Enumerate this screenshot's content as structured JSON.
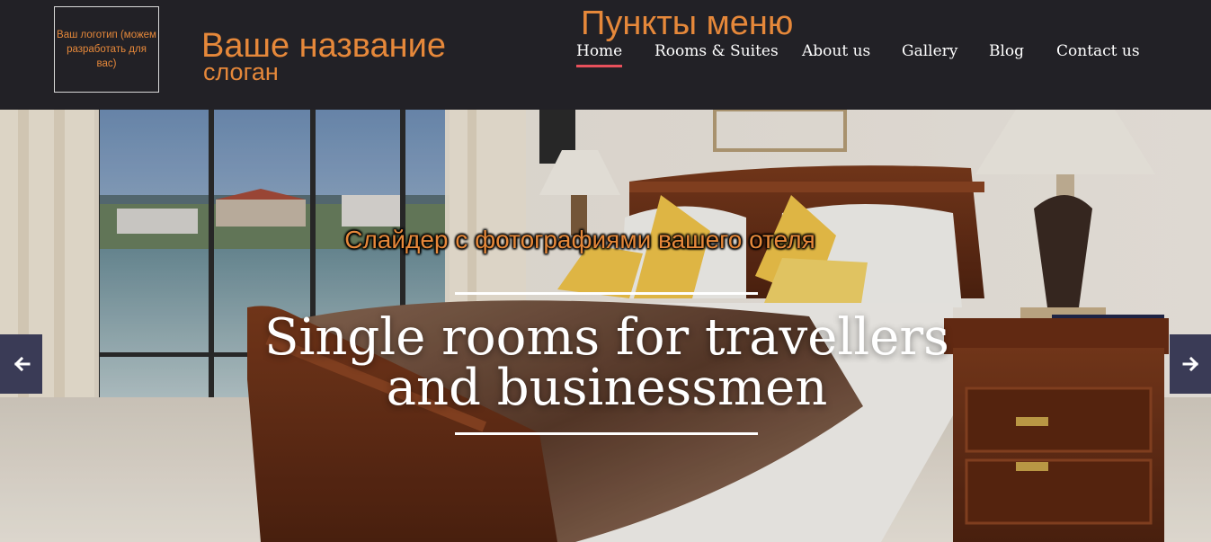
{
  "header": {
    "logo_text": "Ваш логотип (можем разработать для вас)",
    "site_title": "Ваше название",
    "slogan": "слоган",
    "menu_caption": "Пункты меню"
  },
  "nav": {
    "items": [
      {
        "label": "Home",
        "active": true
      },
      {
        "label": "Rooms & Suites",
        "active": false
      },
      {
        "label": "About us",
        "active": false
      },
      {
        "label": "Gallery",
        "active": false
      },
      {
        "label": "Blog",
        "active": false
      },
      {
        "label": "Contact us",
        "active": false
      }
    ]
  },
  "slider": {
    "caption": "Слайдер с фотографиями вашего отеля",
    "title_line1": "Single rooms for travellers",
    "title_line2": "and businessmen",
    "prev_icon": "arrow-left-icon",
    "next_icon": "arrow-right-icon"
  },
  "colors": {
    "header_bg": "#222126",
    "accent_orange": "#e6883a",
    "active_underline": "#e8505b",
    "arrow_bg": "#3a3b56"
  }
}
